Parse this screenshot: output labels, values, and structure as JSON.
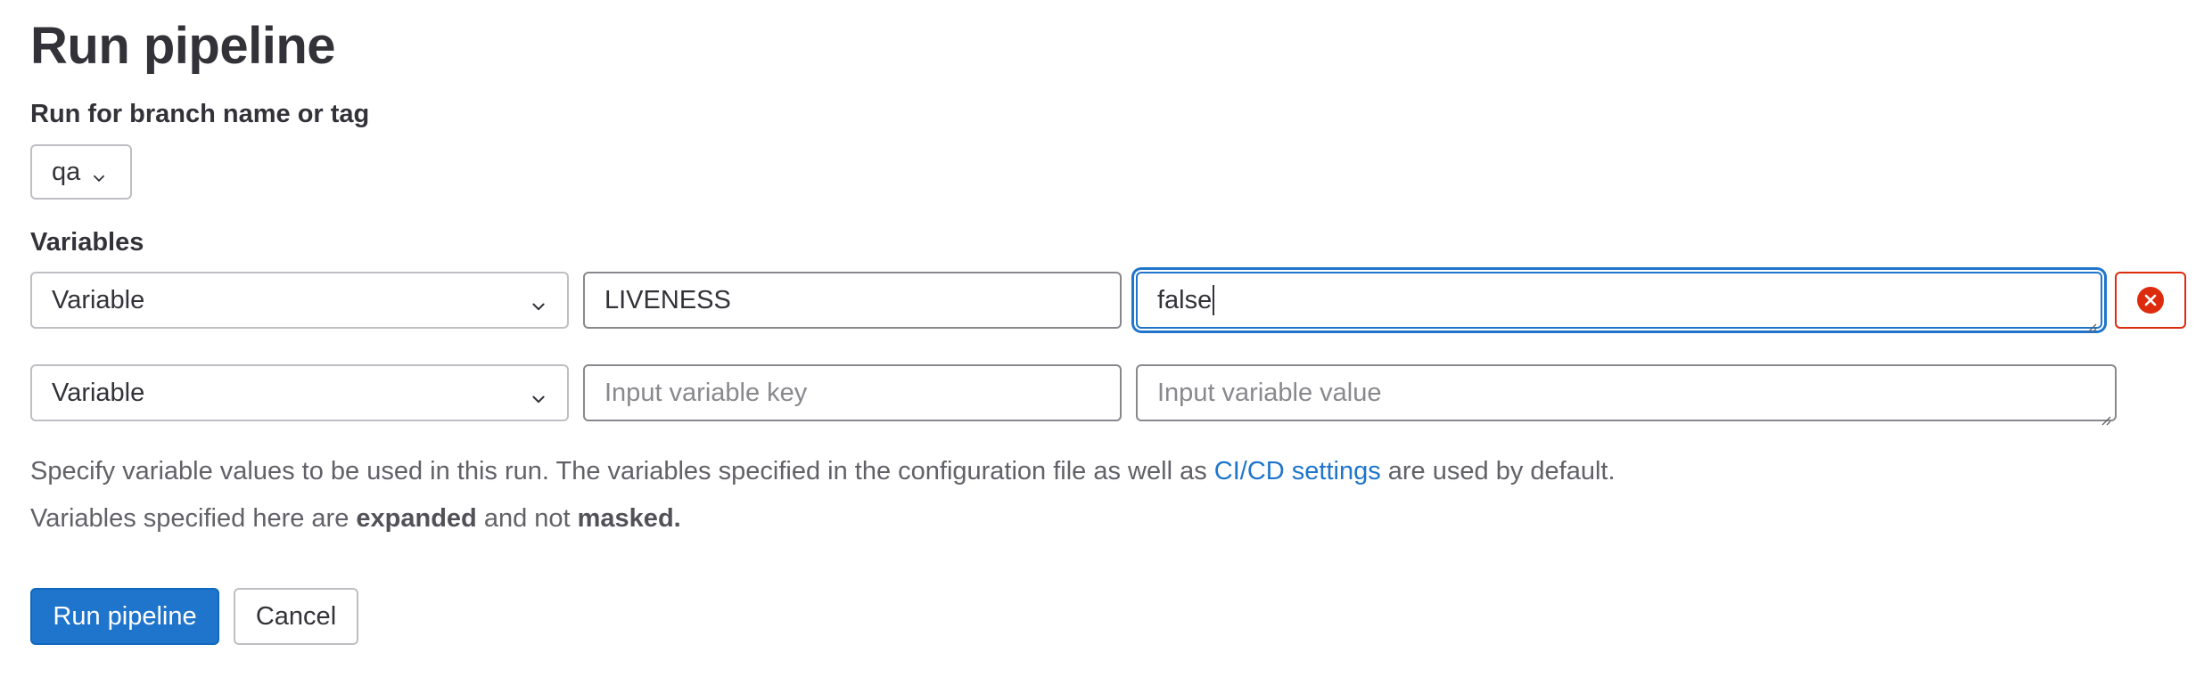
{
  "page": {
    "title": "Run pipeline"
  },
  "branch": {
    "label": "Run for branch name or tag",
    "selected": "qa"
  },
  "variables": {
    "label": "Variables",
    "rows": [
      {
        "type": "Variable",
        "key": "LIVENESS",
        "value": "false"
      },
      {
        "type": "Variable",
        "key_placeholder": "Input variable key",
        "value_placeholder": "Input variable value"
      }
    ]
  },
  "help": {
    "line1_before": "Specify variable values to be used in this run. The variables specified in the configuration file as well as ",
    "line1_link": "CI/CD settings",
    "line1_after": " are used by default.",
    "line2_before": "Variables specified here are ",
    "line2_bold1": "expanded",
    "line2_middle": " and not ",
    "line2_bold2": "masked."
  },
  "actions": {
    "run_label": "Run pipeline",
    "cancel_label": "Cancel"
  },
  "icons": {
    "dropdown": "chevron-down-icon",
    "remove": "remove-icon",
    "resize": "resize-grip-icon"
  },
  "colors": {
    "primary": "#1f75cb",
    "danger": "#dd2b0e",
    "text": "#333238",
    "muted": "#626168"
  }
}
